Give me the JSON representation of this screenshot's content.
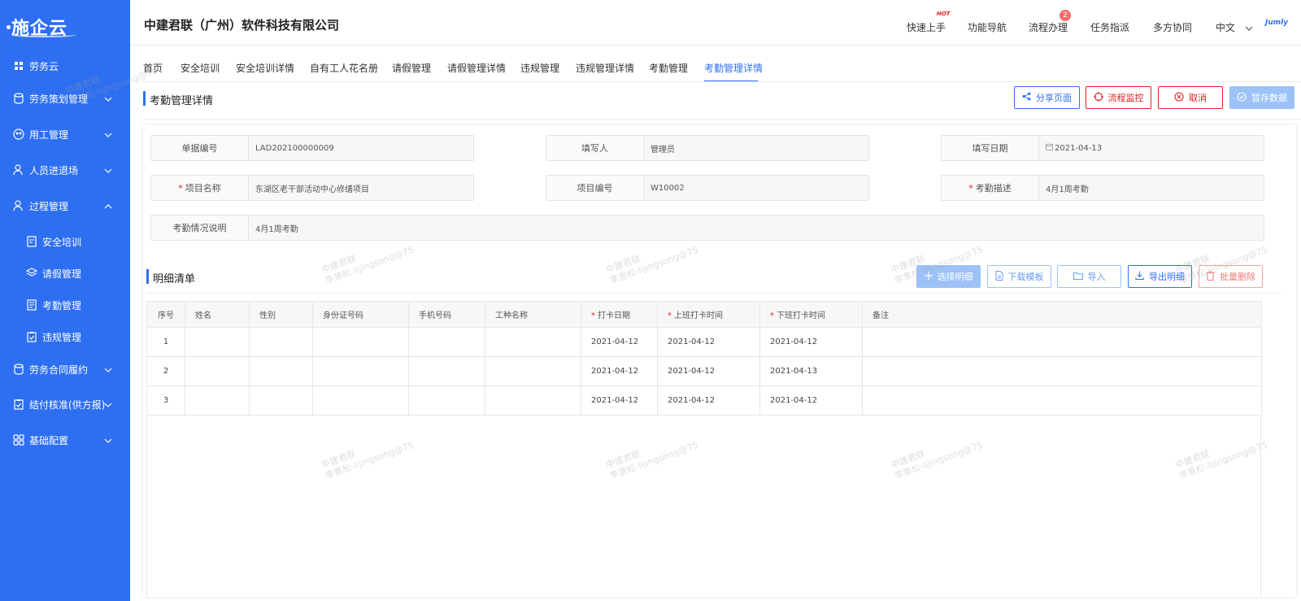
{
  "brand": {
    "name": "施企云"
  },
  "sidebar": {
    "items": [
      {
        "label": "劳务云"
      },
      {
        "label": "劳务策划管理"
      },
      {
        "label": "用工管理"
      },
      {
        "label": "人员进退场"
      },
      {
        "label": "过程管理"
      },
      {
        "label": "安全培训"
      },
      {
        "label": "请假管理"
      },
      {
        "label": "考勤管理"
      },
      {
        "label": "违规管理"
      },
      {
        "label": "劳务合同履约"
      },
      {
        "label": "结付核准(供方报)"
      },
      {
        "label": "基础配置"
      }
    ]
  },
  "header": {
    "company": "中建君联（广州）软件科技有限公司",
    "nav": [
      "快速上手",
      "功能导航",
      "流程办理",
      "任务指派",
      "多方协同",
      "中文"
    ],
    "hot_badge": "HOT",
    "process_count": "2",
    "user_logo": "Jumly"
  },
  "tabs": [
    "首页",
    "安全培训",
    "安全培训详情",
    "自有工人花名册",
    "请假管理",
    "请假管理详情",
    "违规管理",
    "违规管理详情",
    "考勤管理",
    "考勤管理详情"
  ],
  "page": {
    "title": "考勤管理详情",
    "buttons": {
      "share": "分享页面",
      "monitor": "流程监控",
      "cancel": "取消",
      "save": "暂存数据"
    }
  },
  "form": {
    "doc_no": {
      "label": "单据编号",
      "value": "LAD202100000009"
    },
    "writer": {
      "label": "填写人",
      "value": "管理员"
    },
    "date": {
      "label": "填写日期",
      "value": "2021-04-13"
    },
    "project_name": {
      "label": "项目名称",
      "value": "东湖区老干部活动中心修缮项目"
    },
    "project_no": {
      "label": "项目编号",
      "value": "W10002"
    },
    "att_desc": {
      "label": "考勤描述",
      "value": "4月1周考勤"
    },
    "att_note": {
      "label": "考勤情况说明",
      "value": "4月1周考勤"
    }
  },
  "detail": {
    "title": "明细清单",
    "buttons": {
      "select": "选择明细",
      "template": "下载模板",
      "import": "导入",
      "export": "导出明细",
      "batch_delete": "批量删除"
    },
    "columns": [
      "序号",
      "姓名",
      "性别",
      "身份证号码",
      "手机号码",
      "工种名称",
      "打卡日期",
      "上班打卡时间",
      "下班打卡时间",
      "备注"
    ],
    "rows": [
      [
        "1",
        "",
        "",
        "",
        "",
        "",
        "2021-04-12",
        "2021-04-12",
        "2021-04-12",
        ""
      ],
      [
        "2",
        "",
        "",
        "",
        "",
        "",
        "2021-04-12",
        "2021-04-12",
        "2021-04-13",
        ""
      ],
      [
        "3",
        "",
        "",
        "",
        "",
        "",
        "2021-04-12",
        "2021-04-12",
        "2021-04-12",
        ""
      ]
    ]
  },
  "watermark": {
    "line1": "中建君联",
    "line2": "李景松-lijingsong@75"
  },
  "colors": {
    "primary": "#2e6ff2",
    "danger": "#e02020",
    "sidebar": "#2e6ff2"
  }
}
